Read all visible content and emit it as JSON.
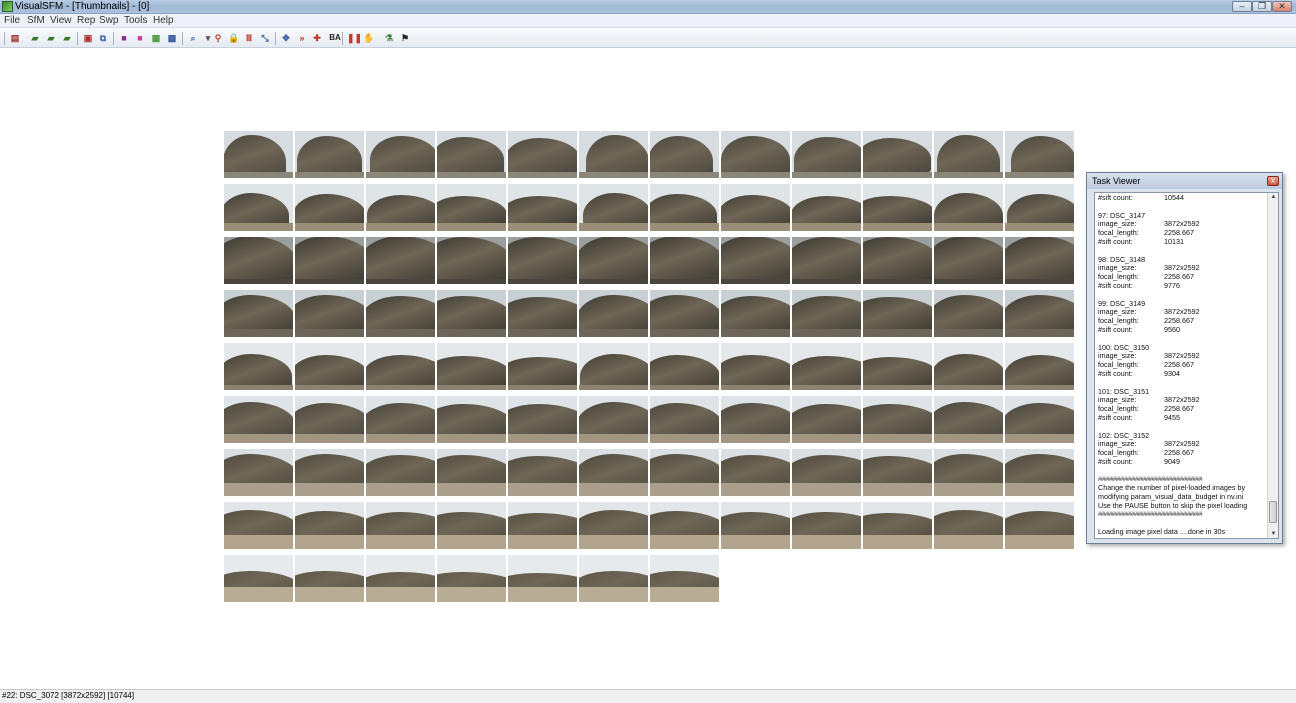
{
  "window": {
    "title": "VisualSFM - [Thumbnails] - [0]"
  },
  "menu": [
    "File",
    "SfM",
    "View",
    "Rep",
    "Swp",
    "Tools",
    "Help"
  ],
  "toolbar": {
    "icons": [
      "new-document-icon",
      "open-icon",
      "open-multiple-icon",
      "open-folder-icon",
      "save-icon",
      "copy-icon",
      "purple-cube-icon",
      "magenta-cube-icon",
      "green-grid-icon",
      "match-icon",
      "zoom-icon",
      "dropdown-icon",
      "connect-icon",
      "lock-icon",
      "nv-icon",
      "sfm-icon",
      "fit-icon",
      "arrow-right-icon",
      "plus-icon",
      "ba-icon",
      "pause-icon",
      "hand-icon",
      "run-icon",
      "dense-icon"
    ],
    "ba_label": "BA"
  },
  "thumbnails": {
    "rows": [
      {
        "count": 12,
        "style": "close-rock"
      },
      {
        "count": 12,
        "style": "arch"
      },
      {
        "count": 12,
        "style": "dark-rock"
      },
      {
        "count": 12,
        "style": "arch-dark"
      },
      {
        "count": 12,
        "style": "slope"
      },
      {
        "count": 12,
        "style": "arch-shore"
      },
      {
        "count": 12,
        "style": "cliff-rocks"
      },
      {
        "count": 12,
        "style": "cliff-beach"
      },
      {
        "count": 7,
        "style": "far-cliff"
      }
    ]
  },
  "task_viewer": {
    "title": "Task Viewer",
    "close": "x",
    "first_line": {
      "k": "#sift count:",
      "v": "10544"
    },
    "entries": [
      {
        "header": "97: DSC_3147",
        "image_size": "3872x2592",
        "focal_length": "2258.667",
        "sift_count": "10131"
      },
      {
        "header": "98: DSC_3148",
        "image_size": "3872x2592",
        "focal_length": "2258.667",
        "sift_count": "9776"
      },
      {
        "header": "99: DSC_3149",
        "image_size": "3872x2592",
        "focal_length": "2258.667",
        "sift_count": "9560"
      },
      {
        "header": "100: DSC_3150",
        "image_size": "3872x2592",
        "focal_length": "2258.667",
        "sift_count": "9304"
      },
      {
        "header": "101: DSC_3151",
        "image_size": "3872x2592",
        "focal_length": "2258.667",
        "sift_count": "9455"
      },
      {
        "header": "102: DSC_3152",
        "image_size": "3872x2592",
        "focal_length": "2258.667",
        "sift_count": "9049"
      }
    ],
    "labels": {
      "image_size": "image_size:",
      "focal_length": "focal_length:",
      "sift_count": "#sift count:"
    },
    "separator": "######################################",
    "notice": [
      "Change the number of pixel-loaded images by",
      "modifying param_visual_data_budget in nv.ini",
      "Use the PAUSE button to skip the pixel loading"
    ],
    "final_line": "Loading image pixel data ....done in 30s"
  },
  "status": {
    "text": "#22: DSC_3072 [3872x2592] [10744]"
  },
  "colors": {
    "titlebar": "#aec3dc",
    "menubar": "#eef2f8",
    "rock_dark": "#3e3a33",
    "sand": "#a3927a",
    "sky": "#dfe4e7"
  }
}
